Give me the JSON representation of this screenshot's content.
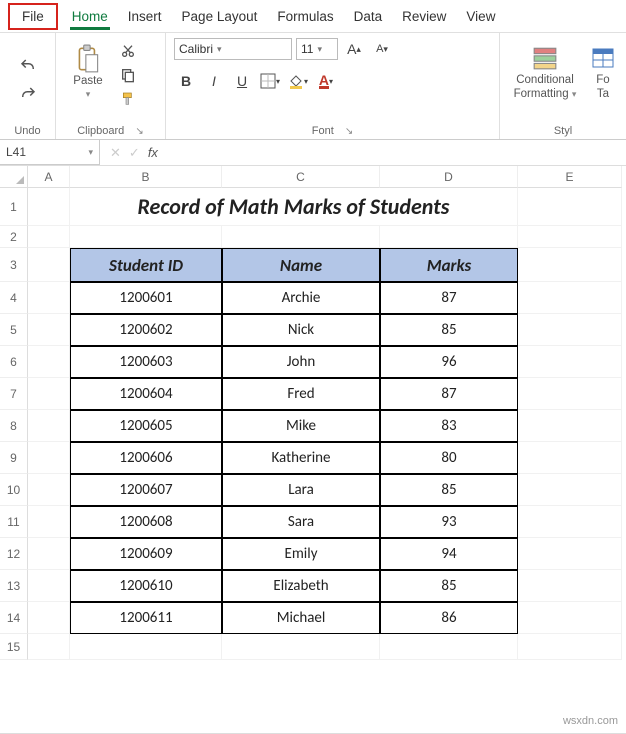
{
  "tabs": {
    "file": "File",
    "home": "Home",
    "insert": "Insert",
    "pagelayout": "Page Layout",
    "formulas": "Formulas",
    "data": "Data",
    "review": "Review",
    "view": "View"
  },
  "ribbon": {
    "undo_label": "Undo",
    "clipboard_label": "Clipboard",
    "paste_label": "Paste",
    "font_label": "Font",
    "font_name": "Calibri",
    "font_size": "11",
    "bold": "B",
    "italic": "I",
    "underline": "U",
    "cond_fmt_line1": "Conditional",
    "cond_fmt_line2": "Formatting",
    "fmt_table_line1": "Fo",
    "fmt_table_line2": "Ta",
    "styles_label": "Styl"
  },
  "formula_bar": {
    "namebox": "L41",
    "fx": "fx"
  },
  "columns": [
    "A",
    "B",
    "C",
    "D",
    "E"
  ],
  "row_numbers": [
    "1",
    "2",
    "3",
    "4",
    "5",
    "6",
    "7",
    "8",
    "9",
    "10",
    "11",
    "12",
    "13",
    "14",
    "15"
  ],
  "sheet": {
    "title": "Record of Math Marks of Students",
    "headers": {
      "id": "Student ID",
      "name": "Name",
      "marks": "Marks"
    },
    "rows": [
      {
        "id": "1200601",
        "name": "Archie",
        "marks": "87"
      },
      {
        "id": "1200602",
        "name": "Nick",
        "marks": "85"
      },
      {
        "id": "1200603",
        "name": "John",
        "marks": "96"
      },
      {
        "id": "1200604",
        "name": "Fred",
        "marks": "87"
      },
      {
        "id": "1200605",
        "name": "Mike",
        "marks": "83"
      },
      {
        "id": "1200606",
        "name": "Katherine",
        "marks": "80"
      },
      {
        "id": "1200607",
        "name": "Lara",
        "marks": "85"
      },
      {
        "id": "1200608",
        "name": "Sara",
        "marks": "93"
      },
      {
        "id": "1200609",
        "name": "Emily",
        "marks": "94"
      },
      {
        "id": "1200610",
        "name": "Elizabeth",
        "marks": "85"
      },
      {
        "id": "1200611",
        "name": "Michael",
        "marks": "86"
      }
    ]
  },
  "watermark": "wsxdn.com"
}
